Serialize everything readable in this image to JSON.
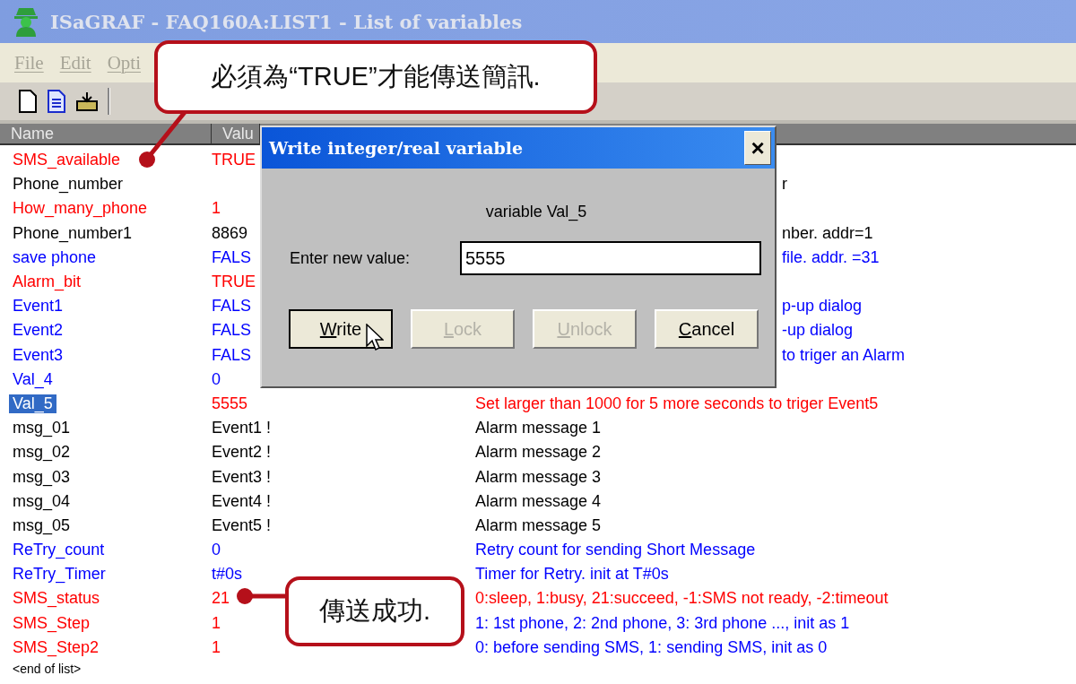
{
  "window": {
    "title": "ISaGRAF - FAQ160A:LIST1 - List of variables"
  },
  "menu": [
    "File",
    "Edit",
    "Opti"
  ],
  "table": {
    "columns": [
      "Name",
      "Valu"
    ],
    "rows": [
      {
        "name": "SMS_available",
        "value": "TRUE",
        "color": "#ff0000",
        "selected": false
      },
      {
        "name": "Phone_number",
        "color": "#000000",
        "comment": {
          "text": "r",
          "cut": true
        },
        "selected": false
      },
      {
        "name": "How_many_phone",
        "value": "1",
        "color": "#ff0000",
        "selected": false
      },
      {
        "name": "Phone_number1",
        "value": "8869",
        "color": "#000000",
        "comment": {
          "text": "nber. addr=1",
          "color": "#000000",
          "cut": true
        },
        "selected": false
      },
      {
        "name": "save phone",
        "value": "FALS",
        "color": "#0000ff",
        "comment": {
          "text": "file. addr. =31",
          "color": "#0000ff",
          "cut": true
        },
        "selected": false
      },
      {
        "name": "Alarm_bit",
        "value": "TRUE",
        "color": "#ff0000",
        "selected": false
      },
      {
        "name": "Event1",
        "value": "FALS",
        "color": "#0000ff",
        "comment": {
          "text": "p-up dialog",
          "color": "#0000ff",
          "cut": true
        },
        "selected": false
      },
      {
        "name": "Event2",
        "value": "FALS",
        "color": "#0000ff",
        "comment": {
          "text": "-up dialog",
          "color": "#0000ff",
          "cut": true
        },
        "selected": false
      },
      {
        "name": "Event3",
        "value": "FALS",
        "color": "#0000ff",
        "comment": {
          "text": "to triger an Alarm",
          "color": "#0000ff",
          "cut": true
        },
        "selected": false
      },
      {
        "name": "Val_4",
        "value": "0",
        "color": "#0000ff",
        "selected": false
      },
      {
        "name": "Val_5",
        "value": "5555",
        "color": "#ff0000",
        "comment": {
          "text": "Set larger than 1000 for 5 more seconds to triger Event5",
          "color": "#ff0000"
        },
        "selected": true
      },
      {
        "name": "msg_01",
        "value": "Event1 !",
        "color": "#000000",
        "comment": {
          "text": "Alarm message 1",
          "color": "#000000"
        },
        "selected": false
      },
      {
        "name": "msg_02",
        "value": "Event2 !",
        "color": "#000000",
        "comment": {
          "text": "Alarm message 2",
          "color": "#000000"
        },
        "selected": false
      },
      {
        "name": "msg_03",
        "value": "Event3 !",
        "color": "#000000",
        "comment": {
          "text": "Alarm message 3",
          "color": "#000000"
        },
        "selected": false
      },
      {
        "name": "msg_04",
        "value": "Event4 !",
        "color": "#000000",
        "comment": {
          "text": "Alarm message 4",
          "color": "#000000"
        },
        "selected": false
      },
      {
        "name": "msg_05",
        "value": "Event5 !",
        "color": "#000000",
        "comment": {
          "text": "Alarm message 5",
          "color": "#000000"
        },
        "selected": false
      },
      {
        "name": "ReTry_count",
        "value": "0",
        "color": "#0000ff",
        "comment": {
          "text": "Retry count for sending Short Message",
          "color": "#0000ff"
        },
        "selected": false
      },
      {
        "name": "ReTry_Timer",
        "value": "t#0s",
        "color": "#0000ff",
        "comment": {
          "text": "Timer for Retry. init at T#0s",
          "color": "#0000ff"
        },
        "selected": false
      },
      {
        "name": "SMS_status",
        "value": "21",
        "color": "#ff0000",
        "comment": {
          "text": "0:sleep, 1:busy, 21:succeed, -1:SMS not ready, -2:timeout",
          "color": "#ff0000"
        },
        "selected": false
      },
      {
        "name": "SMS_Step",
        "value": "1",
        "color": "#ff0000",
        "comment": {
          "text": "1: 1st phone, 2: 2nd phone, 3: 3rd phone ..., init as 1",
          "color": "#0000ff"
        },
        "selected": false
      },
      {
        "name": "SMS_Step2",
        "value": "1",
        "color": "#ff0000",
        "comment": {
          "text": "0: before sending SMS, 1: sending SMS, init as 0",
          "color": "#0000ff"
        },
        "selected": false
      }
    ],
    "end_marker": "<end of list>"
  },
  "dialog": {
    "title": "Write integer/real variable",
    "close": "×",
    "subject": "variable Val_5",
    "label": "Enter new value:",
    "value": "5555",
    "buttons": [
      {
        "label": "Write",
        "disabled": false,
        "default": true
      },
      {
        "label": "Lock",
        "disabled": true,
        "default": false
      },
      {
        "label": "Unlock",
        "disabled": true,
        "default": false
      },
      {
        "label": "Cancel",
        "disabled": false,
        "default": false
      }
    ]
  },
  "callouts": [
    {
      "kind": "top",
      "text": "必須為“TRUE”才能傳送簡訊."
    },
    {
      "kind": "bottom",
      "text": "傳送成功."
    }
  ]
}
